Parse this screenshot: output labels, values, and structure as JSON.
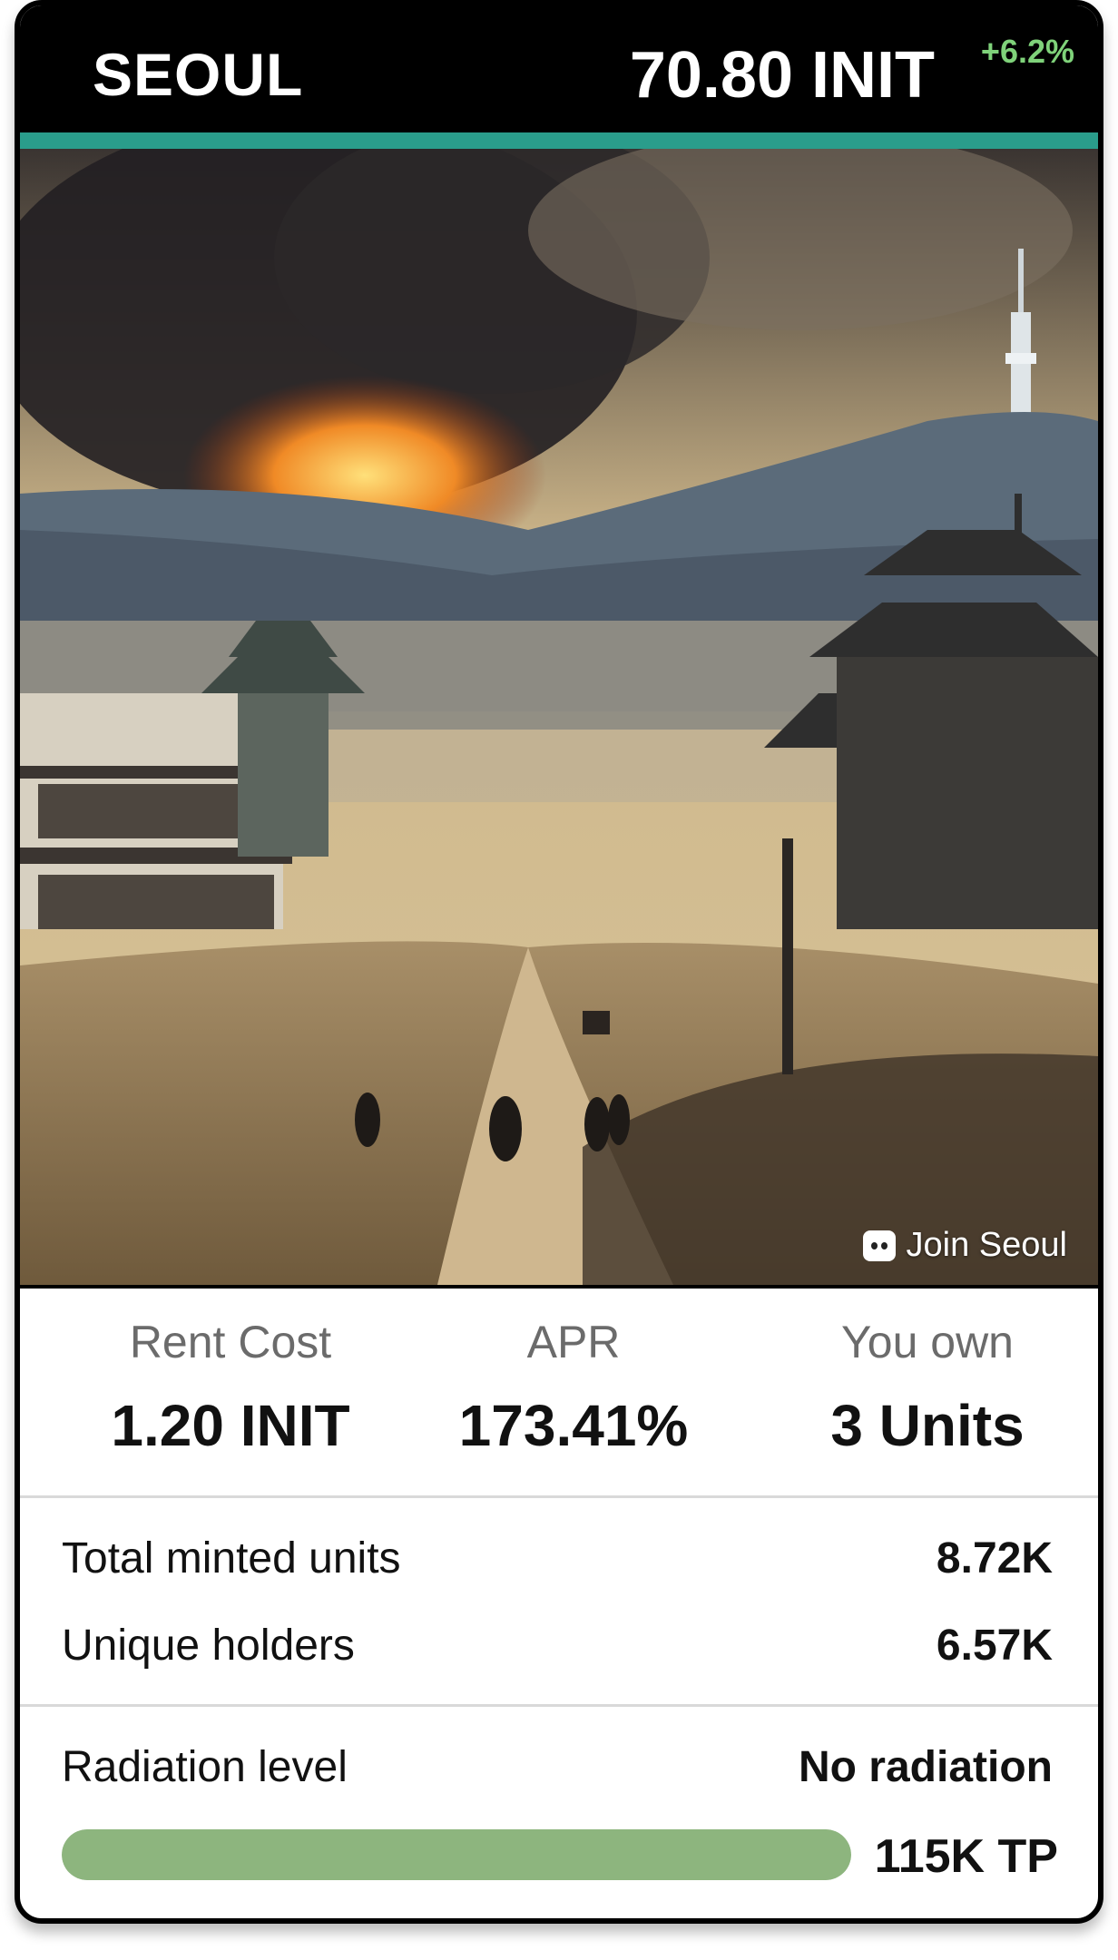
{
  "header": {
    "city": "SEOUL",
    "price": "70.80 INIT",
    "change": "+6.2%"
  },
  "hero": {
    "join_label": "Join Seoul",
    "icon": "discord-icon"
  },
  "stats": [
    {
      "label": "Rent Cost",
      "value": "1.20 INIT"
    },
    {
      "label": "APR",
      "value": "173.41%"
    },
    {
      "label": "You own",
      "value": "3 Units"
    }
  ],
  "details": {
    "total_minted_label": "Total minted units",
    "total_minted_value": "8.72K",
    "unique_holders_label": "Unique holders",
    "unique_holders_value": "6.57K",
    "radiation_label": "Radiation level",
    "radiation_value": "No radiation",
    "tp_value": "115K TP",
    "radiation_bar_fraction": 1.0
  },
  "colors": {
    "accent": "#2a9d8b",
    "positive": "#7fd27a",
    "meter": "#8db57e"
  }
}
